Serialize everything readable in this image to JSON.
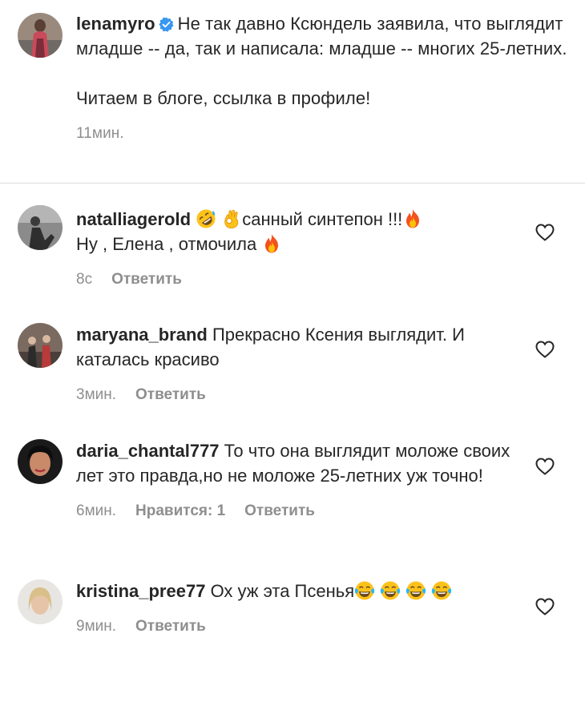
{
  "caption": {
    "username": "lenamyro",
    "text_line1": "Не так давно Ксюндель заявила, что выглядит младше -- да, так и написала: младше -- многих 25-летних.",
    "text_line2": "Читаем в блоге, ссылка в профиле!",
    "time": "11мин."
  },
  "comments": [
    {
      "username": "natalliagerold",
      "text_a": "санный синтепон !!!",
      "text_b": "Ну , Елена , отмочила",
      "time": "8с",
      "reply": "Ответить"
    },
    {
      "username": "maryana_brand",
      "text": "Прекрасно Ксения выглядит. И каталась красиво",
      "time": "3мин.",
      "reply": "Ответить"
    },
    {
      "username": "daria_chantal777",
      "text": "То что она выглядит моложе своих лет это правда,но не моложе 25-летних уж точно!",
      "time": "6мин.",
      "likes": "Нравится: 1",
      "reply": "Ответить"
    },
    {
      "username": "kristina_pree77",
      "text": "Ох уж эта Псенья",
      "time": "9мин.",
      "reply": "Ответить"
    }
  ],
  "icons": {
    "verified": "verified-badge-icon",
    "like": "heart-icon",
    "emojis": [
      "rofl-emoji",
      "ok-hand-emoji",
      "fire-emoji",
      "joy-emoji"
    ]
  },
  "colors": {
    "text": "#262626",
    "secondary": "#8e8e8e",
    "verified_blue": "#3897f0",
    "divider": "#dbdbdb"
  }
}
